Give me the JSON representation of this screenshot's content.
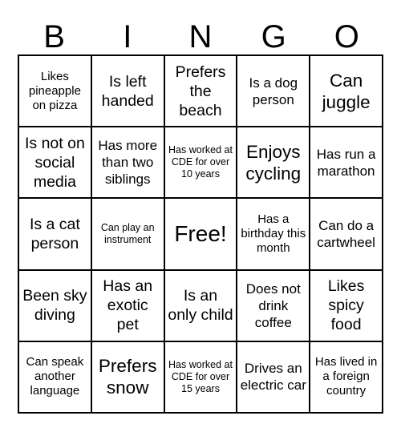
{
  "card": {
    "title_letters": [
      "B",
      "I",
      "N",
      "G",
      "O"
    ],
    "columns": 5,
    "rows": 5,
    "border_color": "#000000",
    "background_color": "#ffffff",
    "text_color": "#000000",
    "cells": [
      {
        "text": "Likes pineapple on pizza",
        "size": "fs-s"
      },
      {
        "text": "Is left handed",
        "size": "fs-l"
      },
      {
        "text": "Prefers the beach",
        "size": "fs-l"
      },
      {
        "text": "Is a dog person",
        "size": "fs-m"
      },
      {
        "text": "Can juggle",
        "size": "fs-xl"
      },
      {
        "text": "Is not on social media",
        "size": "fs-l"
      },
      {
        "text": "Has more than two siblings",
        "size": "fs-m"
      },
      {
        "text": "Has worked at CDE for over 10 years",
        "size": "fs-xs"
      },
      {
        "text": "Enjoys cycling",
        "size": "fs-xl"
      },
      {
        "text": "Has run a marathon",
        "size": "fs-m"
      },
      {
        "text": "Is a cat person",
        "size": "fs-l"
      },
      {
        "text": "Can play an instrument",
        "size": "fs-xs"
      },
      {
        "text": "Free!",
        "size": "fs-xxl"
      },
      {
        "text": "Has a birthday this month",
        "size": "fs-s"
      },
      {
        "text": "Can do a cartwheel",
        "size": "fs-m"
      },
      {
        "text": "Been sky diving",
        "size": "fs-l"
      },
      {
        "text": "Has an exotic pet",
        "size": "fs-l"
      },
      {
        "text": "Is an only child",
        "size": "fs-l"
      },
      {
        "text": "Does not drink coffee",
        "size": "fs-m"
      },
      {
        "text": "Likes spicy food",
        "size": "fs-l"
      },
      {
        "text": "Can speak another language",
        "size": "fs-s"
      },
      {
        "text": "Prefers snow",
        "size": "fs-xl"
      },
      {
        "text": "Has worked at CDE for over 15 years",
        "size": "fs-xs"
      },
      {
        "text": "Drives an electric car",
        "size": "fs-m"
      },
      {
        "text": "Has lived in a foreign country",
        "size": "fs-s"
      }
    ]
  }
}
